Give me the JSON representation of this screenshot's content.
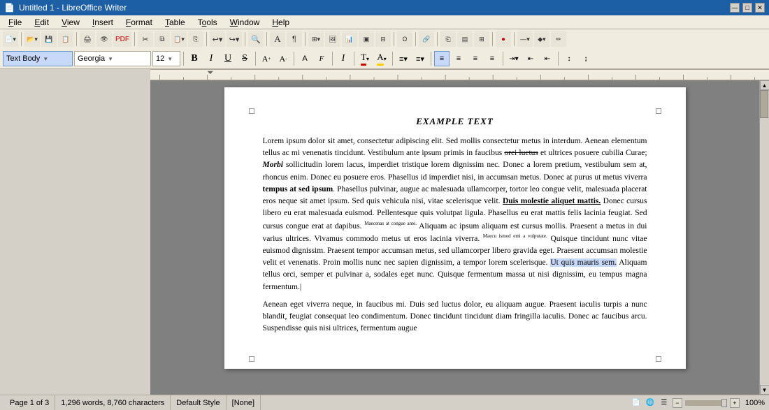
{
  "titlebar": {
    "title": "Untitled 1 - LibreOffice Writer",
    "icon": "📄",
    "controls": [
      "—",
      "□",
      "✕"
    ]
  },
  "menubar": {
    "items": [
      {
        "label": "File",
        "underline_index": 0
      },
      {
        "label": "Edit",
        "underline_index": 0
      },
      {
        "label": "View",
        "underline_index": 0
      },
      {
        "label": "Insert",
        "underline_index": 0
      },
      {
        "label": "Format",
        "underline_index": 0
      },
      {
        "label": "Table",
        "underline_index": 0
      },
      {
        "label": "Tools",
        "underline_index": 0
      },
      {
        "label": "Window",
        "underline_index": 0
      },
      {
        "label": "Help",
        "underline_index": 0
      }
    ]
  },
  "toolbar2": {
    "style_dropdown": "Text Body",
    "font_dropdown": "Georgia",
    "font_size": "12",
    "buttons": [
      "B",
      "I",
      "U",
      "S",
      "A",
      "A",
      "A",
      "F",
      "I",
      "T",
      "A",
      "≡",
      "≡",
      "≡",
      "≡",
      "≡",
      "≡",
      "≡",
      "≡"
    ]
  },
  "document": {
    "title": "EXAMPLE TEXT",
    "paragraphs": [
      "Lorem ipsum dolor sit amet, consectetur adipiscing elit. Sed mollis consectetur metus in interdum. Aenean elementum tellus ac mi venenatis tincidunt. Vestibulum ante ipsum primis in faucibus orei luetus et ultrices posuere cubilia Curae; Morbi sollicitudin lorem lacus, imperdiet tristique lorem dignissim nec. Donec a lorem pretium, vestibulum sem at, rhoncus enim. Donec eu posuere eros. Phasellus id imperdiet nisi, in accumsan metus. Donec at purus ut metus viverra tempus at sed ipsum. Phasellus pulvinar, augue ac malesuada ullamcorper, tortor leo congue velit, malesuada placerat eros neque sit amet ipsum. Sed quis vehicula nisi, vitae scelerisque velit. Duis molestie aliquet mattis. Donec cursus libero eu erat malesuada euismod. Pellentesque quis volutpat ligula. Phasellus eu erat mattis felis lacinia feugiat. Sed cursus congue erat at dapibus. Maecenas at congue ante. Aliquam ac ipsum aliquam est cursus mollis. Praesent a metus in dui varius ultrices. Vivamus commodo metus ut eros lacinia viverra. Maecuismod emi a vulputate. Quisque tincidunt nunc vitae euismod dignissim. Praesent tempor accumsan metus, sed ullamcorper libero gravida eget. Praesent accumsan molestie velit et venenatis. Proin mollis nunc nec sapien dignissim, a tempor lorem scelerisque. Ut quis mauris sem. Aliquam tellus orci, semper et pulvinar a, sodales eget nunc. Quisque fermentum massa ut nisi dignissim, eu tempus magna fermentum.",
      "Aenean eget viverra neque, in faucibus mi. Duis sed luctus dolor, eu aliquam augue. Praesent iaculis turpis a nunc blandit, feugiat consequat leo condimentum. Donec tincidunt tincidunt diam fringilla iaculis. Donec ac faucibus arcu. Suspendisse quis nisi ultrices, fermentum augue"
    ]
  },
  "statusbar": {
    "page": "Page 1 of 3",
    "words": "1,296 words, 8,760 characters",
    "style": "Default Style",
    "language": "[None]",
    "zoom": "100%",
    "zoom_value": 100
  }
}
